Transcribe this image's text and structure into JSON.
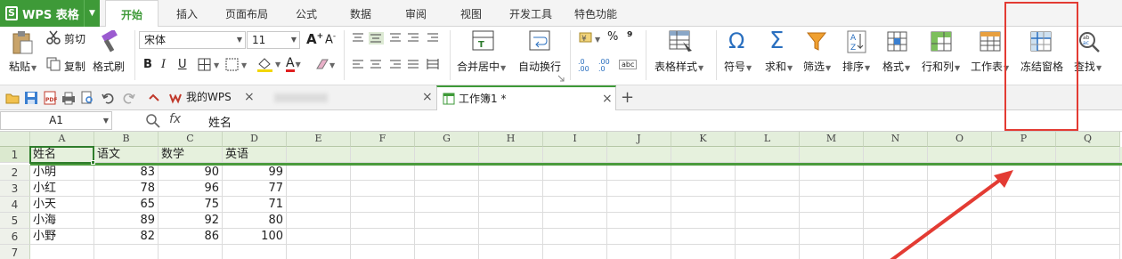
{
  "menubar": {
    "app_button": "WPS 表格",
    "tabs": [
      "开始",
      "插入",
      "页面布局",
      "公式",
      "数据",
      "审阅",
      "视图",
      "开发工具",
      "特色功能"
    ]
  },
  "ribbon": {
    "paste": "粘贴",
    "cut": "剪切",
    "copy": "复制",
    "format_painter": "格式刷",
    "font_name": "宋体",
    "font_size": "11",
    "bold": "B",
    "italic": "I",
    "underline": "U",
    "font_color_letter": "A",
    "merge_center": "合并居中",
    "wrap_text": "自动换行",
    "percent": "%",
    "comma": "⁹",
    "table_style": "表格样式",
    "symbol": "符号",
    "sum": "求和",
    "filter": "筛选",
    "sort": "排序",
    "format": "格式",
    "row_col": "行和列",
    "worksheet": "工作表",
    "freeze": "冻结窗格",
    "find": "查找"
  },
  "docbar": {
    "my_wps": "我的WPS",
    "workbook": "工作簿1 *",
    "add": "+"
  },
  "formula": {
    "cell_ref": "A1",
    "fx": "fx",
    "value": "姓名"
  },
  "sheet": {
    "columns": [
      "A",
      "B",
      "C",
      "D",
      "E",
      "F",
      "G",
      "H",
      "I",
      "J",
      "K",
      "L",
      "M",
      "N",
      "O",
      "P",
      "Q"
    ],
    "row_numbers": [
      "1",
      "2",
      "3",
      "4",
      "5",
      "6",
      "7"
    ],
    "header": [
      "姓名",
      "语文",
      "数学",
      "英语"
    ],
    "rows": [
      [
        "小明",
        "83",
        "90",
        "99"
      ],
      [
        "小红",
        "78",
        "96",
        "77"
      ],
      [
        "小天",
        "65",
        "75",
        "71"
      ],
      [
        "小海",
        "89",
        "92",
        "80"
      ],
      [
        "小野",
        "82",
        "86",
        "100"
      ]
    ]
  },
  "colors": {
    "accent": "#3e9a38",
    "highlight_box": "#e33b33",
    "arrow": "#e33b33"
  }
}
